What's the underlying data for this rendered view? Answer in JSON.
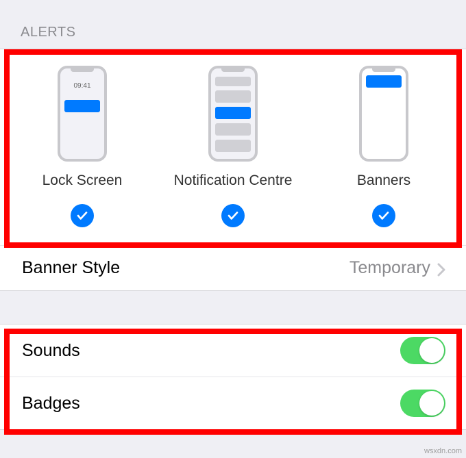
{
  "sectionHeader": "ALERTS",
  "alerts": {
    "lockScreen": {
      "label": "Lock Screen",
      "time": "09:41",
      "checked": true
    },
    "notificationCentre": {
      "label": "Notification Centre",
      "checked": true
    },
    "banners": {
      "label": "Banners",
      "checked": true
    }
  },
  "bannerStyle": {
    "label": "Banner Style",
    "value": "Temporary"
  },
  "sounds": {
    "label": "Sounds",
    "enabled": true
  },
  "badges": {
    "label": "Badges",
    "enabled": true
  },
  "watermark": "wsxdn.com"
}
